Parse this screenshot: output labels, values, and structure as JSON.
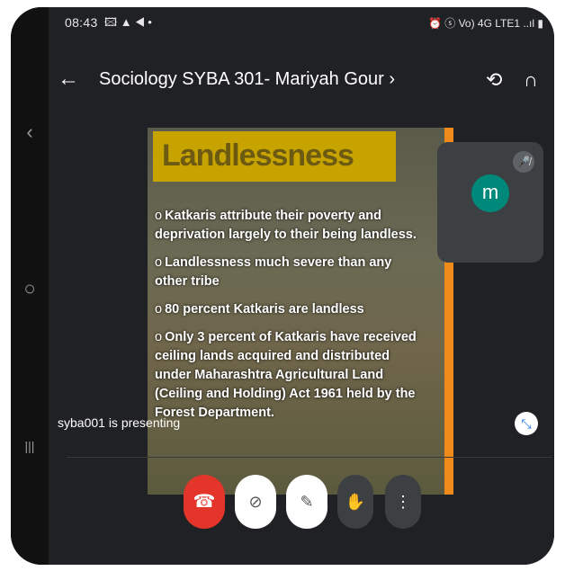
{
  "status": {
    "time": "08:43",
    "left_icons": "🖾 ▲ ◀ •",
    "right_icons": "⏰ ⓢ Vo) 4G LTE1 ..ıl ▮"
  },
  "header": {
    "back_glyph": "←",
    "title": "Sociology SYBA 301- Mariyah Gour",
    "title_chevron": "›",
    "switch_camera_glyph": "⟲",
    "audio_glyph": "∩"
  },
  "slide": {
    "title": "Landlessness",
    "bullets": [
      "Katkaris attribute their poverty and deprivation largely to their being landless.",
      "Landlessness much severe than any other tribe",
      "80 percent Katkaris are landless",
      "Only 3 percent of Katkaris have received ceiling lands acquired and distributed under Maharashtra Agricultural Land (Ceiling and Holding) Act 1961 held by the Forest Department."
    ],
    "bullet_mark": "o"
  },
  "presenting_text": "syba001 is presenting",
  "participant": {
    "initial": "m",
    "mic_glyph": "🎤̸"
  },
  "minimize_glyph": "⤡",
  "controls": {
    "end_glyph": "☎",
    "camera_glyph": "⊘",
    "mic_glyph": "✎",
    "hand_glyph": "✋",
    "more_glyph": "⋮"
  },
  "nav": {
    "back": "‹",
    "home": "○",
    "recents": "|||"
  },
  "colors": {
    "end_call": "#e3352a",
    "avatar": "#00897b",
    "slide_accent": "#f08a1a"
  }
}
